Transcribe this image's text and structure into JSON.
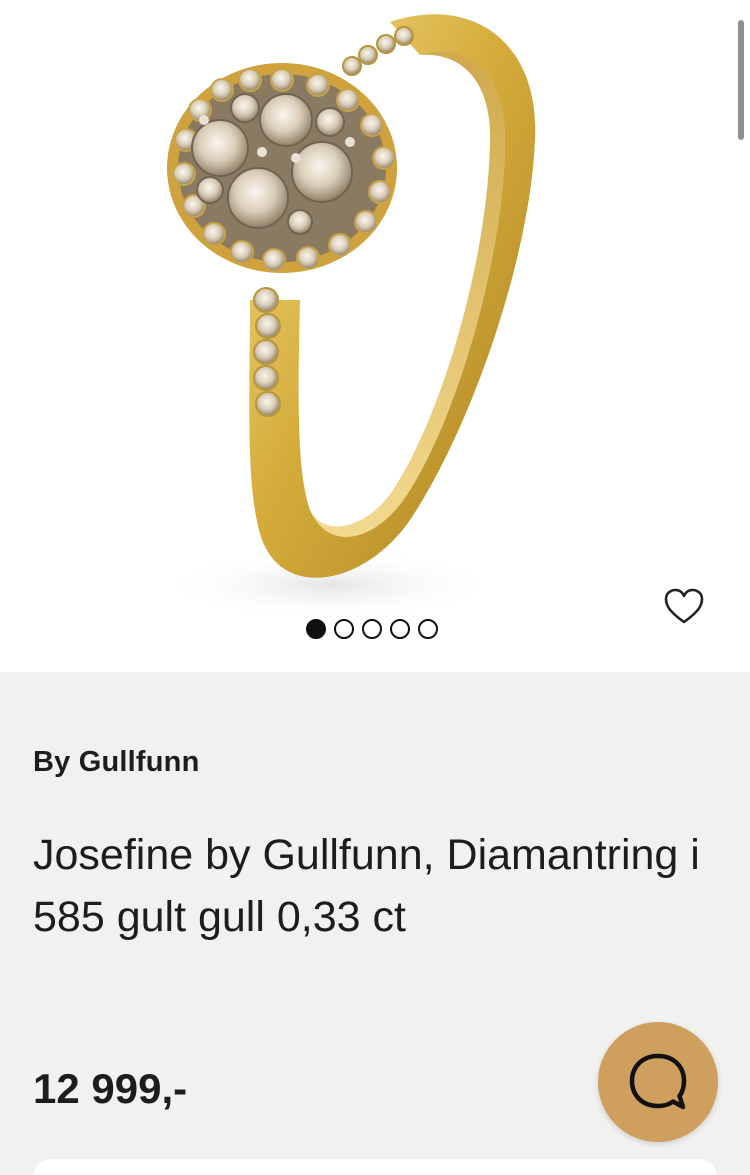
{
  "product": {
    "brand": "By Gullfunn",
    "title": "Josefine by Gullfunn, Diamantring i 585 gult gull 0,33 ct",
    "price": "12 999,-"
  },
  "gallery": {
    "image_count": 5,
    "active_index": 0
  },
  "icons": {
    "favorite": "heart-outline-icon",
    "chat": "chat-bubble-icon"
  },
  "colors": {
    "info_background": "#f1f1f0",
    "chat_button": "#cf9f5d",
    "gold": "#d9b44a",
    "text": "#1d1d1d"
  }
}
